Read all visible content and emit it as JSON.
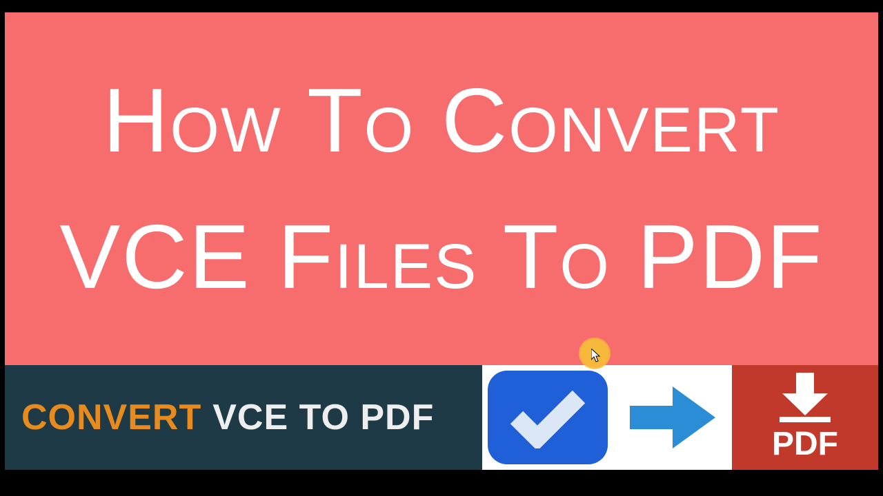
{
  "hero": {
    "line1": "How to Convert",
    "line2": "VCE Files to PDF"
  },
  "strip": {
    "word1": "CONVERT",
    "word2": "VCE TO PDF",
    "pdf_label": "PDF"
  },
  "colors": {
    "hero_bg": "#f76c6c",
    "strip_bg": "#1e3a47",
    "orange": "#e88b1f",
    "blue": "#1f5fd8",
    "pdf_red": "#c0392b",
    "cursor_glow": "#f6b93b"
  },
  "icons": {
    "check": "check-icon",
    "arrow": "arrow-right-icon",
    "download": "download-icon",
    "cursor": "cursor-icon"
  }
}
